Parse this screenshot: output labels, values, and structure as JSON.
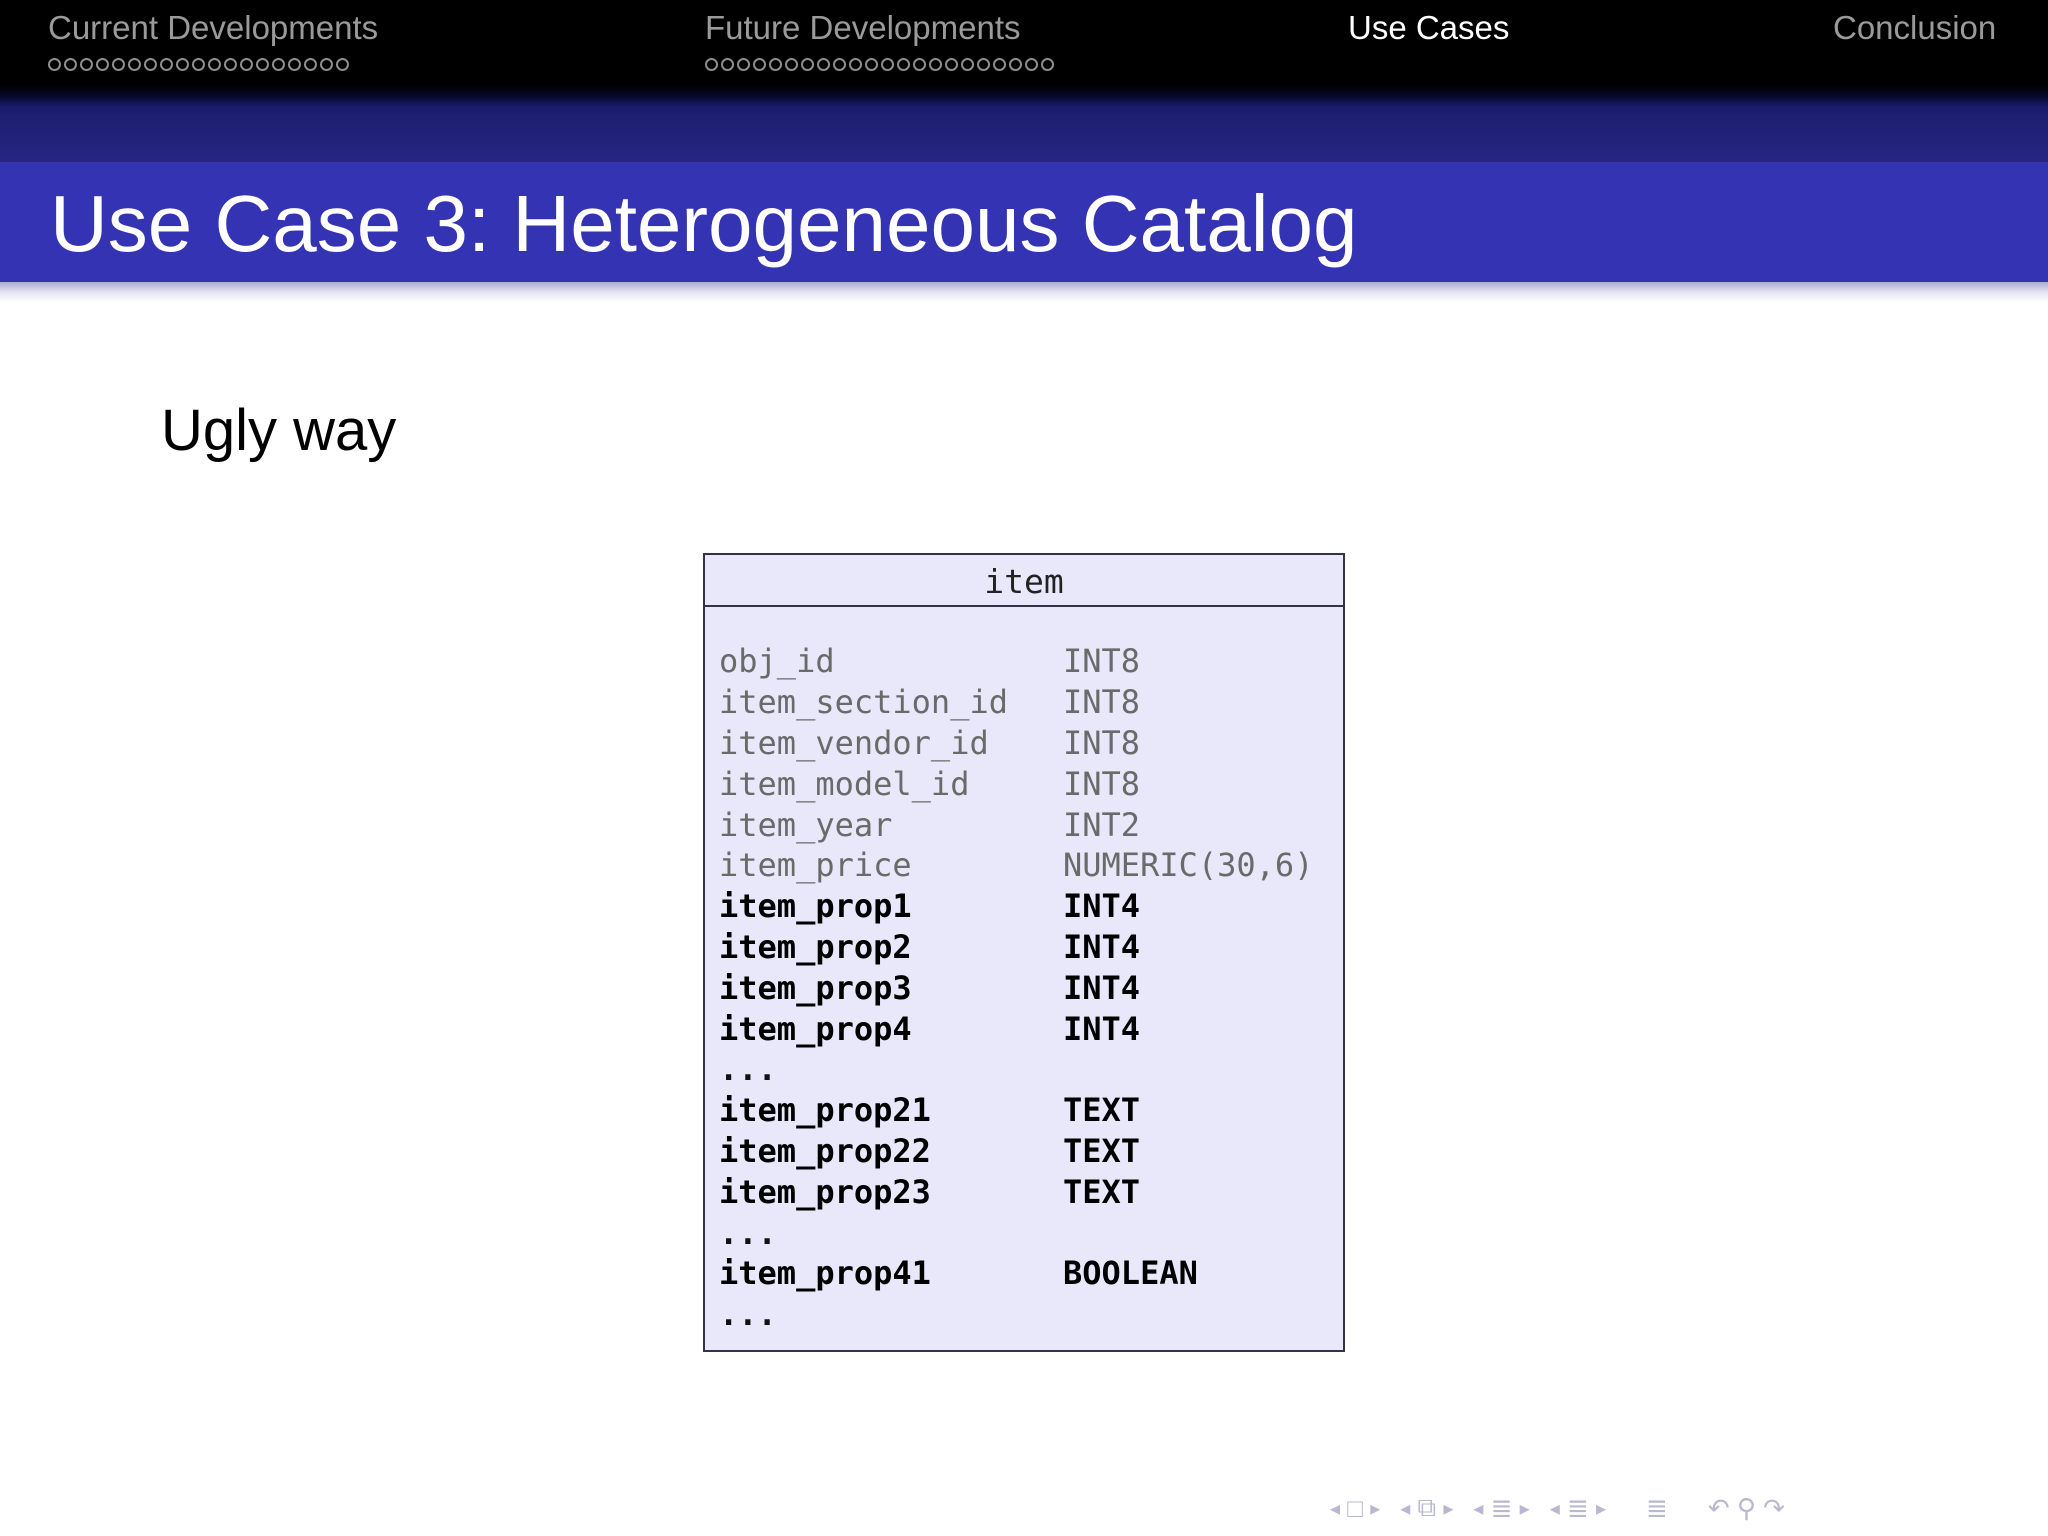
{
  "nav": {
    "sections": [
      {
        "title": "Current Developments",
        "dots": 19,
        "active": false
      },
      {
        "title": "Future Developments",
        "dots": 22,
        "active": false
      },
      {
        "title": "Use Cases",
        "dots": 0,
        "active": true
      },
      {
        "title": "Conclusion",
        "dots": 0,
        "active": false
      }
    ]
  },
  "frame": {
    "title": "Use Case 3: Heterogeneous Catalog"
  },
  "content": {
    "heading": "Ugly way",
    "table": {
      "name": "item",
      "rows": [
        {
          "name": "obj_id",
          "type": "INT8",
          "style": "light"
        },
        {
          "name": "item_section_id",
          "type": "INT8",
          "style": "light"
        },
        {
          "name": "item_vendor_id",
          "type": "INT8",
          "style": "light"
        },
        {
          "name": "item_model_id",
          "type": "INT8",
          "style": "light"
        },
        {
          "name": "item_year",
          "type": "INT2",
          "style": "light"
        },
        {
          "name": "item_price",
          "type": "NUMERIC(30,6)",
          "style": "light"
        },
        {
          "name": "item_prop1",
          "type": "INT4",
          "style": "bold"
        },
        {
          "name": "item_prop2",
          "type": "INT4",
          "style": "bold"
        },
        {
          "name": "item_prop3",
          "type": "INT4",
          "style": "bold"
        },
        {
          "name": "item_prop4",
          "type": "INT4",
          "style": "bold"
        },
        {
          "name": "...",
          "type": "",
          "style": "ellipsis"
        },
        {
          "name": "item_prop21",
          "type": "TEXT",
          "style": "bold"
        },
        {
          "name": "item_prop22",
          "type": "TEXT",
          "style": "bold"
        },
        {
          "name": "item_prop23",
          "type": "TEXT",
          "style": "bold"
        },
        {
          "name": "...",
          "type": "",
          "style": "ellipsis"
        },
        {
          "name": "item_prop41",
          "type": "BOOLEAN",
          "style": "bold"
        },
        {
          "name": "...",
          "type": "",
          "style": "ellipsis"
        }
      ]
    }
  },
  "navsymbols": [
    "slide-left-arrow-icon",
    "slide-frame-icon",
    "slide-right-arrow-icon",
    "frame-left-arrow-icon",
    "frame-icon",
    "frame-right-arrow-icon",
    "subsection-left-arrow-icon",
    "subsection-icon",
    "subsection-right-arrow-icon",
    "section-left-arrow-icon",
    "section-icon",
    "section-right-arrow-icon",
    "document-icon",
    "back-icon",
    "search-icon",
    "forward-icon"
  ],
  "colors": {
    "header_bg": "#000000",
    "subband": "#1c1c6e",
    "title_bar": "#3333b3",
    "table_fill": "#e8e8fa",
    "nav_inactive": "#9a9a9a",
    "nav_active": "#ffffff"
  }
}
